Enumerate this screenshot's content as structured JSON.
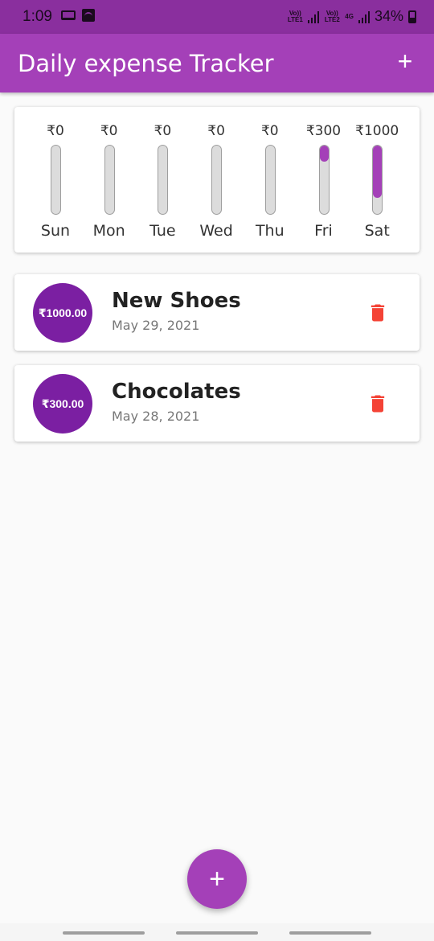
{
  "status_bar": {
    "time": "1:09",
    "sim1_label": "Vo)) LTE1",
    "sim2_label": "Vo)) LTE2",
    "network_4g": "4G",
    "battery": "34%"
  },
  "app_bar": {
    "title": "Daily expense Tracker",
    "add_icon": "plus-icon",
    "add_label": "+"
  },
  "chart_data": {
    "type": "bar",
    "categories": [
      "Sun",
      "Mon",
      "Tue",
      "Wed",
      "Thu",
      "Fri",
      "Sat"
    ],
    "values": [
      0,
      0,
      0,
      0,
      0,
      300,
      1000
    ],
    "value_labels": [
      "₹0",
      "₹0",
      "₹0",
      "₹0",
      "₹0",
      "₹300",
      "₹1000"
    ],
    "fill_fraction": [
      0,
      0,
      0,
      0,
      0,
      0.23,
      0.77
    ],
    "bar_color": "#a440b8",
    "track_color": "#dcdcdc"
  },
  "transactions": [
    {
      "amount": "₹1000.00",
      "title": "New Shoes",
      "date": "May 29, 2021",
      "delete_icon": "trash-icon"
    },
    {
      "amount": "₹300.00",
      "title": "Chocolates",
      "date": "May 28, 2021",
      "delete_icon": "trash-icon"
    }
  ],
  "fab": {
    "icon": "plus-icon",
    "label": "+"
  },
  "colors": {
    "primary": "#a440b8",
    "primary_dark": "#7b1fa2",
    "delete": "#f44336"
  }
}
